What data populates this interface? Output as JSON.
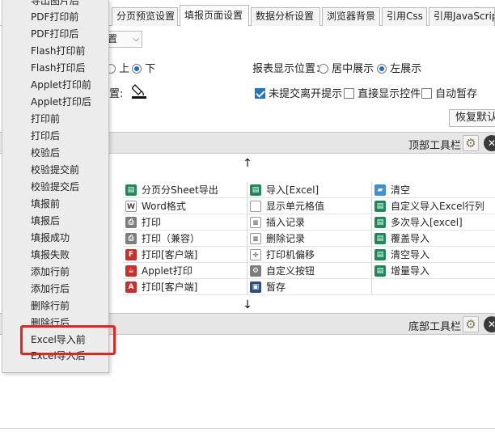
{
  "tabs": [
    {
      "label": "分页预览设置",
      "active": false
    },
    {
      "label": "填报页面设置",
      "active": true
    },
    {
      "label": "数据分析设置",
      "active": false
    },
    {
      "label": "浏览器背景",
      "active": false
    },
    {
      "label": "引用Css",
      "active": false
    },
    {
      "label": "引用JavaScript",
      "active": false
    }
  ],
  "settings": {
    "combo_value": "置",
    "radio_up": "上",
    "radio_down": "下",
    "report_position_label": "报表显示位置：",
    "position_center": "居中展示",
    "position_left": "左展示",
    "position_selected": "左展示",
    "position_label_partial": "置:",
    "unsubmitted_prompt": "未提交离开提示",
    "unsubmitted_checked": true,
    "show_controls": "直接显示控件",
    "show_controls_checked": false,
    "autosave": "自动暂存",
    "autosave_checked": false,
    "restore_default": "恢复默认"
  },
  "top_toolbar": {
    "label": "顶部工具栏"
  },
  "bottom_toolbar": {
    "label": "底部工具栏"
  },
  "grid": [
    [
      "分页分Sheet导出",
      "导入[Excel]",
      "清空"
    ],
    [
      "Word格式",
      "显示单元格值",
      "自定义导入Excel行列"
    ],
    [
      "打印",
      "插入记录",
      "多次导入[excel]"
    ],
    [
      "打印（兼容）",
      "删除记录",
      "覆盖导入"
    ],
    [
      "打印[客户端]",
      "打印机偏移",
      "清空导入"
    ],
    [
      "Applet打印",
      "自定义按钮",
      "增量导入"
    ],
    [
      "打印[客户端]",
      "暂存",
      ""
    ]
  ],
  "grid_icons": [
    [
      "sheet-export-icon",
      "excel-import-icon",
      "eraser-icon"
    ],
    [
      "word-icon",
      "cell-value-icon",
      "custom-import-icon"
    ],
    [
      "printer-icon",
      "insert-row-icon",
      "multi-import-icon"
    ],
    [
      "printer-icon",
      "delete-row-icon",
      "overwrite-import-icon"
    ],
    [
      "client-print-icon",
      "offset-move-icon",
      "clear-import-icon"
    ],
    [
      "applet-print-icon",
      "custom-button-gear-icon",
      "incremental-import-icon"
    ],
    [
      "pdf-print-icon",
      "save-disk-icon",
      ""
    ]
  ],
  "popup_items": [
    "导出图片后",
    "PDF打印前",
    "PDF打印后",
    "Flash打印前",
    "Flash打印后",
    "Applet打印前",
    "Applet打印后",
    "打印前",
    "打印后",
    "校验后",
    "校验提交前",
    "校验提交后",
    "填报前",
    "填报后",
    "填报成功",
    "填报失败",
    "添加行前",
    "添加行后",
    "删除行前",
    "删除行后",
    "Excel导入前",
    "Excel导入后"
  ],
  "highlighted_item": "Excel导入前",
  "colors": {
    "highlight": "#e8231b",
    "bar_bg": "#e6e6e6",
    "popup_bg": "#ececec",
    "accent": "#1c74d4"
  }
}
